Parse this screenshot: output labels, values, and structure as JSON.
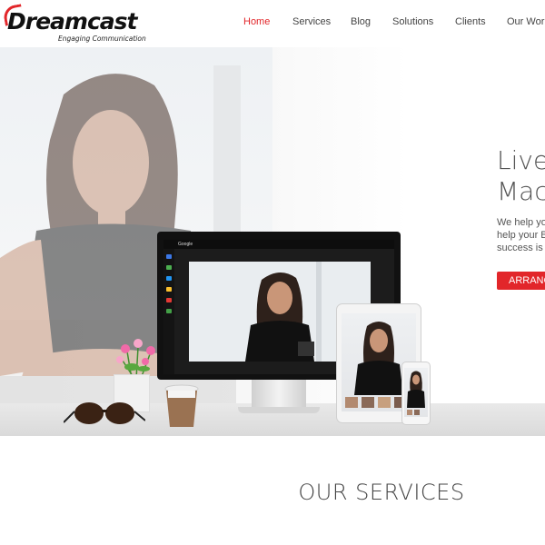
{
  "brand": {
    "name": "Dreamcast",
    "tagline": "Engaging Communication",
    "accent_color": "#e2262a"
  },
  "nav": {
    "items": [
      {
        "label": "Home",
        "active": true
      },
      {
        "label": "Services",
        "active": false
      },
      {
        "label": "Blog",
        "active": false
      },
      {
        "label": "Solutions",
        "active": false
      },
      {
        "label": "Clients",
        "active": false
      },
      {
        "label": "Our Work",
        "active": false
      }
    ]
  },
  "hero": {
    "title_line1": "Live",
    "title_line2": "Mac",
    "text_line1": "We help yo",
    "text_line2": "help your B",
    "text_line3": "success is",
    "cta_label": "ARRANG",
    "app_bar_label": "Google"
  },
  "services": {
    "title": "OUR SERVICES"
  }
}
